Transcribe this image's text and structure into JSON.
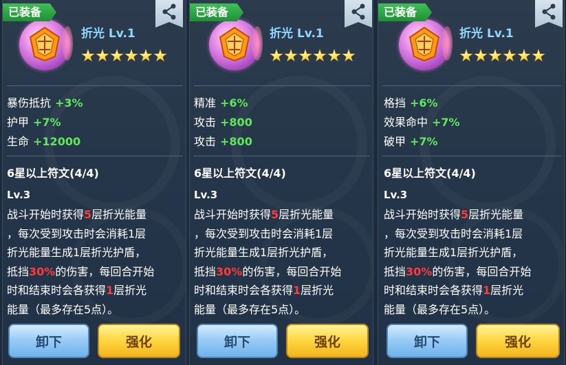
{
  "cards": [
    {
      "badge": "已装备",
      "name": "折光 Lv.1",
      "stars": 6,
      "attributes": [
        {
          "label": "暴伤抵抗",
          "value": "+3%"
        },
        {
          "label": "护甲",
          "value": "+7%"
        },
        {
          "label": "生命",
          "value": "+12000"
        }
      ],
      "set_title": "6星以上符文(4/4)",
      "level": "Lv.3",
      "desc": {
        "l1a": "战斗开始时获得",
        "l1r": "5",
        "l1b": "层折光能量",
        "l2": "，每次受到攻击时会消耗1层",
        "l3": "折光能量生成1层折光护盾，",
        "l4a": "抵挡",
        "l4r": "30%",
        "l4b": "的伤害，每回合开始",
        "l5a": "时和结束时会各获得",
        "l5r": "1",
        "l5b": "层折光",
        "l6": "能量（最多存在5点）。"
      },
      "unequip_label": "卸下",
      "enhance_label": "强化"
    },
    {
      "badge": "已装备",
      "name": "折光 Lv.1",
      "stars": 6,
      "attributes": [
        {
          "label": "精准",
          "value": "+6%"
        },
        {
          "label": "攻击",
          "value": "+800"
        },
        {
          "label": "攻击",
          "value": "+800"
        }
      ],
      "set_title": "6星以上符文(4/4)",
      "level": "Lv.3",
      "desc": {
        "l1a": "战斗开始时获得",
        "l1r": "5",
        "l1b": "层折光能量",
        "l2": "，每次受到攻击时会消耗1层",
        "l3": "折光能量生成1层折光护盾，",
        "l4a": "抵挡",
        "l4r": "30%",
        "l4b": "的伤害，每回合开始",
        "l5a": "时和结束时会各获得",
        "l5r": "1",
        "l5b": "层折光",
        "l6": "能量（最多存在5点）。"
      },
      "unequip_label": "卸下",
      "enhance_label": "强化"
    },
    {
      "badge": "已装备",
      "name": "折光 Lv.1",
      "stars": 6,
      "attributes": [
        {
          "label": "格挡",
          "value": "+6%"
        },
        {
          "label": "效果命中",
          "value": "+7%"
        },
        {
          "label": "破甲",
          "value": "+7%"
        }
      ],
      "set_title": "6星以上符文(4/4)",
      "level": "Lv.3",
      "desc": {
        "l1a": "战斗开始时获得",
        "l1r": "5",
        "l1b": "层折光能量",
        "l2": "，每次受到攻击时会消耗1层",
        "l3": "折光能量生成1层折光护盾，",
        "l4a": "抵挡",
        "l4r": "30%",
        "l4b": "的伤害，每回合开始",
        "l5a": "时和结束时会各获得",
        "l5r": "1",
        "l5b": "层折光",
        "l6": "能量（最多存在5点）。"
      },
      "unequip_label": "卸下",
      "enhance_label": "强化"
    }
  ],
  "icons": {
    "share": "share-icon",
    "rune": "refraction-rune-icon",
    "star": "star-icon"
  },
  "colors": {
    "badge_green": "#2fa846",
    "value_green": "#5ee85a",
    "highlight_red": "#ff3b3b",
    "name_blue": "#8fd8ff"
  }
}
